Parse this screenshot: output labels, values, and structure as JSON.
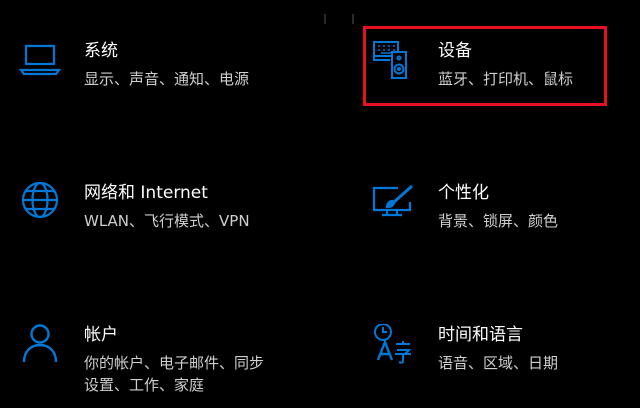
{
  "colors": {
    "accent": "#0078d7",
    "highlight": "#e81123",
    "background": "#000000",
    "title": "#ffffff",
    "description": "#cfcfcf"
  },
  "tiles": [
    {
      "id": "system",
      "icon": "laptop-icon",
      "title": "系统",
      "desc": [
        "显示、声音、通知、电源"
      ]
    },
    {
      "id": "devices",
      "icon": "devices-keyboard-speaker-icon",
      "title": "设备",
      "desc": [
        "蓝牙、打印机、鼠标"
      ],
      "highlighted": true
    },
    {
      "id": "network",
      "icon": "globe-icon",
      "title": "网络和 Internet",
      "desc": [
        "WLAN、飞行模式、VPN"
      ]
    },
    {
      "id": "personalization",
      "icon": "paint-monitor-icon",
      "title": "个性化",
      "desc": [
        "背景、锁屏、颜色"
      ]
    },
    {
      "id": "accounts",
      "icon": "person-icon",
      "title": "帐户",
      "desc": [
        "你的帐户、电子邮件、同步",
        "设置、工作、家庭"
      ]
    },
    {
      "id": "time-language",
      "icon": "time-language-icon",
      "title": "时间和语言",
      "desc": [
        "语音、区域、日期"
      ]
    }
  ]
}
